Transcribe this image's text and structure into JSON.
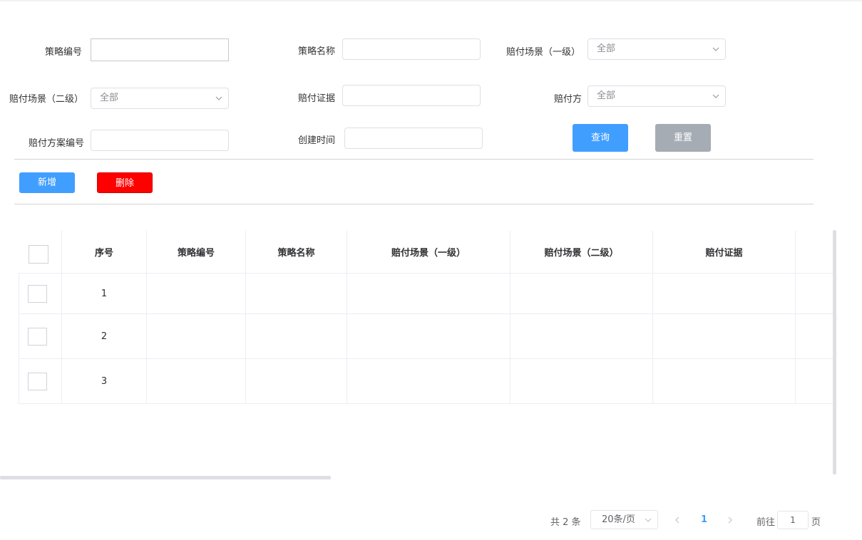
{
  "filters": {
    "strategy_no_label": "策略编号",
    "strategy_name_label": "策略名称",
    "scene_l1_label": "赔付场景（一级）",
    "scene_l1_value": "全部",
    "scene_l2_label": "赔付场景（二级）",
    "scene_l2_value": "全部",
    "evidence_label": "赔付证据",
    "payer_label": "赔付方",
    "payer_value": "全部",
    "plan_no_label": "赔付方案编号",
    "created_time_label": "创建时间"
  },
  "actions": {
    "query": "查询",
    "reset": "重置",
    "add": "新增",
    "delete": "删除"
  },
  "table": {
    "headers": [
      "序号",
      "策略编号",
      "策略名称",
      "赔付场景（一级）",
      "赔付场景（二级）",
      "赔付证据"
    ],
    "rows": [
      {
        "index": "1"
      },
      {
        "index": "2"
      },
      {
        "index": "3"
      }
    ]
  },
  "pagination": {
    "total": "共 2 条",
    "page_size": "20条/页",
    "current_page": "1",
    "goto_prefix": "前往",
    "goto_value": "1",
    "goto_suffix": "页",
    "active_color": "#409eff"
  },
  "colors": {
    "primary": "#409eff",
    "danger": "#ff0000",
    "reset": "#a5acb4"
  }
}
